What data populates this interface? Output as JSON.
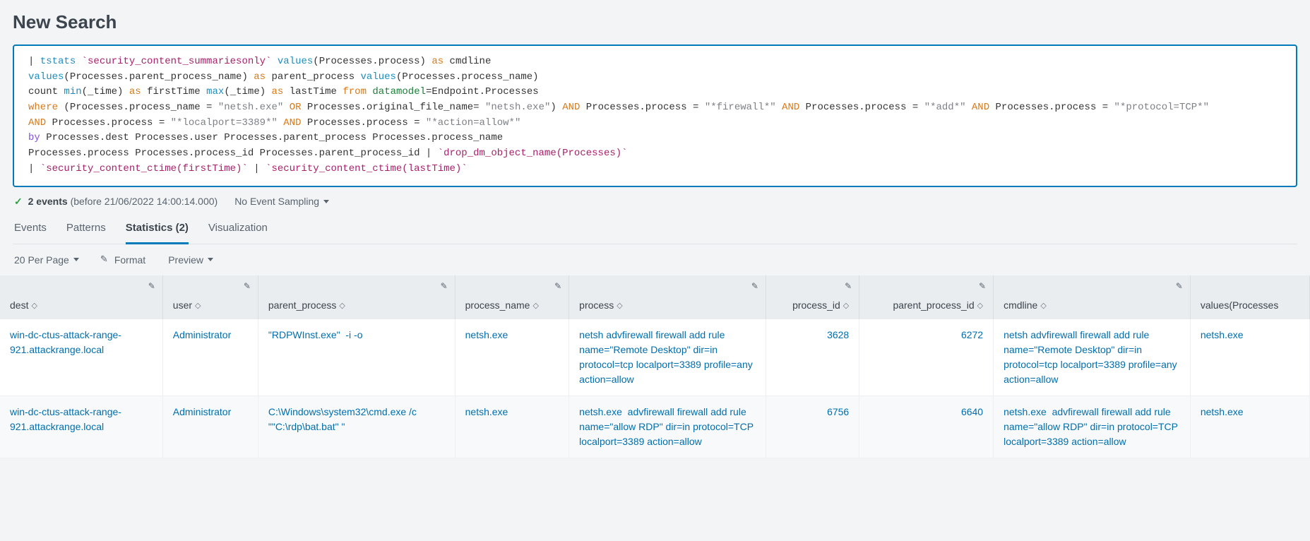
{
  "page_title": "New Search",
  "status": {
    "events_count": "2 events",
    "before_text": "(before 21/06/2022 14:00:14.000)",
    "sampling": "No Event Sampling"
  },
  "tabs": {
    "events": "Events",
    "patterns": "Patterns",
    "statistics": "Statistics (2)",
    "visualization": "Visualization"
  },
  "toolbar": {
    "per_page": "20 Per Page",
    "format": "Format",
    "preview": "Preview"
  },
  "search_tokens": [
    {
      "t": "pipe",
      "v": "| "
    },
    {
      "t": "cmd",
      "v": "tstats "
    },
    {
      "t": "macro",
      "v": "`security_content_summariesonly` "
    },
    {
      "t": "func",
      "v": "values"
    },
    {
      "t": "arg",
      "v": "(Processes.process) "
    },
    {
      "t": "as",
      "v": "as "
    },
    {
      "t": "arg",
      "v": "cmdline\n"
    },
    {
      "t": "func",
      "v": "values"
    },
    {
      "t": "arg",
      "v": "(Processes.parent_process_name) "
    },
    {
      "t": "as",
      "v": "as "
    },
    {
      "t": "arg",
      "v": "parent_process "
    },
    {
      "t": "func",
      "v": "values"
    },
    {
      "t": "arg",
      "v": "(Processes.process_name)\n"
    },
    {
      "t": "arg",
      "v": "count "
    },
    {
      "t": "func",
      "v": "min"
    },
    {
      "t": "arg",
      "v": "(_time) "
    },
    {
      "t": "as",
      "v": "as "
    },
    {
      "t": "arg",
      "v": "firstTime "
    },
    {
      "t": "func",
      "v": "max"
    },
    {
      "t": "arg",
      "v": "(_time) "
    },
    {
      "t": "as",
      "v": "as "
    },
    {
      "t": "arg",
      "v": "lastTime "
    },
    {
      "t": "from",
      "v": "from "
    },
    {
      "t": "dm",
      "v": "datamodel"
    },
    {
      "t": "arg",
      "v": "=Endpoint.Processes\n"
    },
    {
      "t": "kw",
      "v": "where "
    },
    {
      "t": "arg",
      "v": "(Processes.process_name = "
    },
    {
      "t": "str",
      "v": "\"netsh.exe\" "
    },
    {
      "t": "kw",
      "v": "OR "
    },
    {
      "t": "arg",
      "v": "Processes.original_file_name= "
    },
    {
      "t": "str",
      "v": "\"netsh.exe\""
    },
    {
      "t": "arg",
      "v": ") "
    },
    {
      "t": "kw",
      "v": "AND "
    },
    {
      "t": "arg",
      "v": "Processes.process = "
    },
    {
      "t": "str",
      "v": "\"*firewall*\" "
    },
    {
      "t": "kw",
      "v": "AND "
    },
    {
      "t": "arg",
      "v": "Processes.process = "
    },
    {
      "t": "str",
      "v": "\"*add*\" "
    },
    {
      "t": "kw",
      "v": "AND "
    },
    {
      "t": "arg",
      "v": "Processes.process = "
    },
    {
      "t": "str",
      "v": "\"*protocol=TCP*\"\n"
    },
    {
      "t": "kw",
      "v": "AND "
    },
    {
      "t": "arg",
      "v": "Processes.process = "
    },
    {
      "t": "str",
      "v": "\"*localport=3389*\" "
    },
    {
      "t": "kw",
      "v": "AND "
    },
    {
      "t": "arg",
      "v": "Processes.process = "
    },
    {
      "t": "str",
      "v": "\"*action=allow*\"\n"
    },
    {
      "t": "by",
      "v": "by "
    },
    {
      "t": "arg",
      "v": "Processes.dest Processes.user Processes.parent_process Processes.process_name\n"
    },
    {
      "t": "arg",
      "v": "Processes.process Processes.process_id Processes.parent_process_id | "
    },
    {
      "t": "macro",
      "v": "`drop_dm_object_name(Processes)`\n"
    },
    {
      "t": "arg",
      "v": "| "
    },
    {
      "t": "macro",
      "v": "`security_content_ctime(firstTime)` "
    },
    {
      "t": "arg",
      "v": "| "
    },
    {
      "t": "macro",
      "v": "`security_content_ctime(lastTime)`"
    }
  ],
  "columns": [
    {
      "key": "dest",
      "label": "dest",
      "type": "text",
      "pencil": true
    },
    {
      "key": "user",
      "label": "user",
      "type": "text",
      "pencil": true
    },
    {
      "key": "parent_process",
      "label": "parent_process",
      "type": "text",
      "pencil": true
    },
    {
      "key": "process_name",
      "label": "process_name",
      "type": "text",
      "pencil": true,
      "stack": true
    },
    {
      "key": "process",
      "label": "process",
      "type": "text",
      "pencil": true
    },
    {
      "key": "process_id",
      "label": "process_id",
      "type": "num",
      "pencil": true,
      "stack": true
    },
    {
      "key": "parent_process_id",
      "label": "parent_process_id",
      "type": "num",
      "pencil": true,
      "stack": true
    },
    {
      "key": "cmdline",
      "label": "cmdline",
      "type": "text",
      "pencil": true
    },
    {
      "key": "values_process",
      "label": "values(Processes",
      "type": "text",
      "pencil": false,
      "truncated": true
    }
  ],
  "rows": [
    {
      "dest": "win-dc-ctus-attack-range-921.attackrange.local",
      "user": "Administrator",
      "parent_process": "\"RDPWInst.exe\"  -i -o",
      "process_name": "netsh.exe",
      "process": "netsh advfirewall firewall add rule name=\"Remote Desktop\" dir=in protocol=tcp localport=3389 profile=any action=allow",
      "process_id": "3628",
      "parent_process_id": "6272",
      "cmdline": "netsh advfirewall firewall add rule name=\"Remote Desktop\" dir=in protocol=tcp localport=3389 profile=any action=allow",
      "values_process": "netsh.exe"
    },
    {
      "dest": "win-dc-ctus-attack-range-921.attackrange.local",
      "user": "Administrator",
      "parent_process": "C:\\Windows\\system32\\cmd.exe /c \"\"C:\\rdp\\bat.bat\" \"",
      "process_name": "netsh.exe",
      "process": "netsh.exe  advfirewall firewall add rule name=\"allow RDP\" dir=in protocol=TCP localport=3389 action=allow",
      "process_id": "6756",
      "parent_process_id": "6640",
      "cmdline": "netsh.exe  advfirewall firewall add rule name=\"allow RDP\" dir=in protocol=TCP localport=3389 action=allow",
      "values_process": "netsh.exe"
    }
  ]
}
